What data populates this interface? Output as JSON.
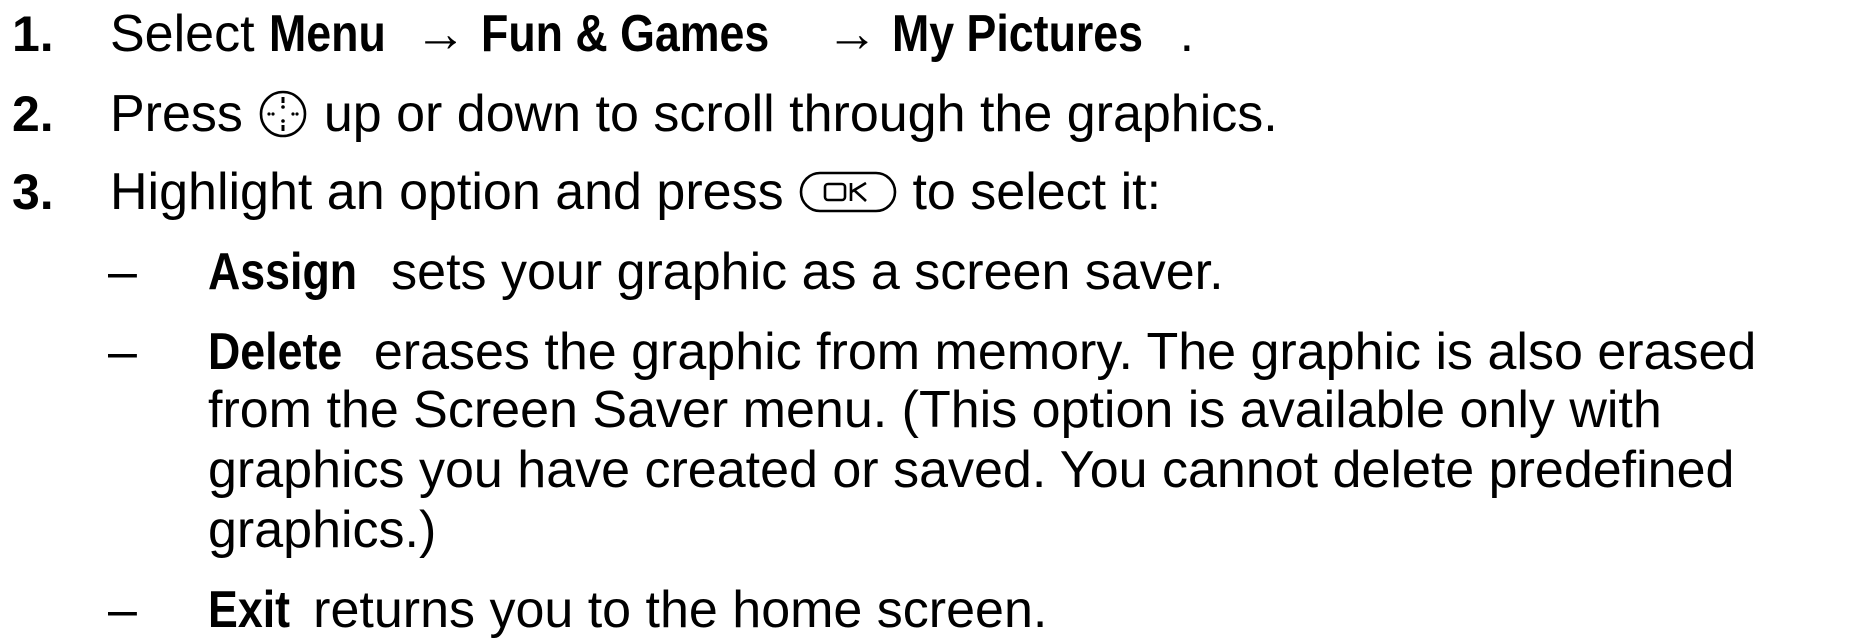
{
  "steps": [
    {
      "number": "1.",
      "before": "Select ",
      "menu": "Menu",
      "arrow1": " → ",
      "fun_games": "Fun & Games",
      "arrow2": " → ",
      "my_pictures": "My Pictures",
      "after": "."
    },
    {
      "number": "2.",
      "before": "Press ",
      "icon": "navigation-key-icon",
      "after": " up or down to scroll through the graphics."
    },
    {
      "number": "3.",
      "before": "Highlight an option and press ",
      "icon": "ok-key-icon",
      "after": " to select it:"
    }
  ],
  "options": [
    {
      "bullet": "–",
      "term": "Assign",
      "text": " sets your graphic as a screen saver."
    },
    {
      "bullet": "–",
      "term": "Delete",
      "line1": " erases the graphic from memory. The graphic is also erased",
      "line2": "from the Screen Saver menu. (This option is available only with",
      "line3": "graphics you have created or saved. You cannot delete predefined",
      "line4": "graphics.)"
    },
    {
      "bullet": "–",
      "term": "Exit",
      "text": " returns you to the home screen."
    }
  ]
}
